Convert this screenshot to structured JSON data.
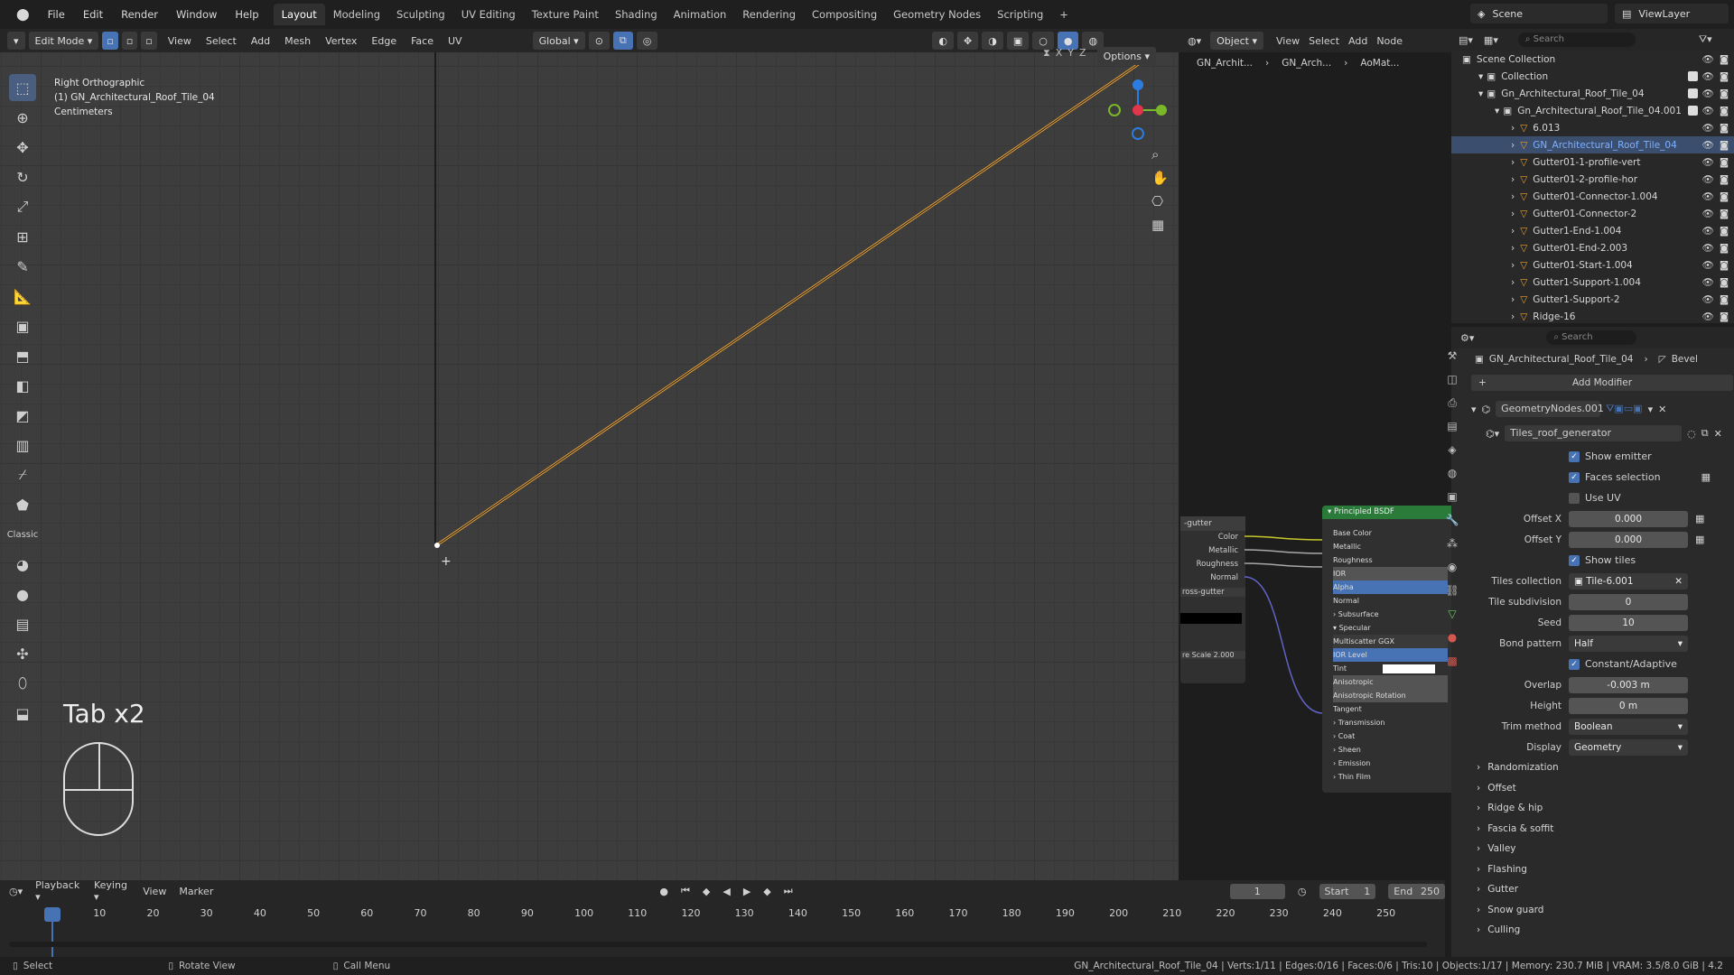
{
  "menu": [
    "File",
    "Edit",
    "Render",
    "Window",
    "Help"
  ],
  "workspaces": [
    "Layout",
    "Modeling",
    "Sculpting",
    "UV Editing",
    "Texture Paint",
    "Shading",
    "Animation",
    "Rendering",
    "Compositing",
    "Geometry Nodes",
    "Scripting"
  ],
  "active_workspace": "Layout",
  "scene": "Scene",
  "view_layer": "ViewLayer",
  "viewport_header": {
    "mode": "Edit Mode",
    "menus": [
      "View",
      "Select",
      "Add",
      "Mesh",
      "Vertex",
      "Edge",
      "Face",
      "UV"
    ],
    "transform": "Global",
    "options": "Options",
    "axes": [
      "X",
      "Y",
      "Z"
    ]
  },
  "viewport_info": [
    "Right Orthographic",
    "(1) GN_Architectural_Roof_Tile_04",
    "Centimeters"
  ],
  "key_overlay": "Tab x2",
  "node_header": {
    "object": "Object",
    "menus": [
      "View",
      "Select",
      "Add",
      "Node"
    ],
    "breadcrumb": [
      "GN_Archit...",
      "GN_Arch...",
      "AoMat..."
    ]
  },
  "nodes": {
    "left": {
      "title": "-gutter",
      "sockets": [
        "Color",
        "Metallic",
        "Roughness",
        "Normal"
      ],
      "material": "ross-gutter",
      "scale": "re Scale  2.000"
    },
    "bsdf": {
      "title": "Principled BSDF",
      "sockets": [
        "Base Color",
        "Metallic",
        "Roughness",
        "IOR",
        "Alpha",
        "Normal",
        "Subsurface",
        "Specular",
        "Multiscatter GGX",
        "IOR Level",
        "Tint",
        "Anisotropic",
        "Anisotropic Rotation",
        "Tangent",
        "Transmission",
        "Coat",
        "Sheen",
        "Emission",
        "Thin Film"
      ]
    }
  },
  "outliner": {
    "search_placeholder": "Search",
    "rows": [
      {
        "label": "Scene Collection",
        "indent": 0
      },
      {
        "label": "Collection",
        "indent": 1
      },
      {
        "label": "Gn_Architectural_Roof_Tile_04",
        "indent": 1
      },
      {
        "label": "Gn_Architectural_Roof_Tile_04.001",
        "indent": 2
      },
      {
        "label": "6.013",
        "indent": 3
      },
      {
        "label": "GN_Architectural_Roof_Tile_04",
        "indent": 3,
        "selected": true
      },
      {
        "label": "Gutter01-1-profile-vert",
        "indent": 3
      },
      {
        "label": "Gutter01-2-profile-hor",
        "indent": 3
      },
      {
        "label": "Gutter01-Connector-1.004",
        "indent": 3
      },
      {
        "label": "Gutter01-Connector-2",
        "indent": 3
      },
      {
        "label": "Gutter1-End-1.004",
        "indent": 3
      },
      {
        "label": "Gutter01-End-2.003",
        "indent": 3
      },
      {
        "label": "Gutter01-Start-1.004",
        "indent": 3
      },
      {
        "label": "Gutter1-Support-1.004",
        "indent": 3
      },
      {
        "label": "Gutter1-Support-2",
        "indent": 3
      },
      {
        "label": "Ridge-16",
        "indent": 3
      }
    ]
  },
  "properties": {
    "search_placeholder": "Search",
    "object_name": "GN_Architectural_Roof_Tile_04",
    "modifier_crumb": "Bevel",
    "add_modifier": "Add Modifier",
    "modifier_name": "GeometryNodes.001",
    "node_group": "Tiles_roof_generator",
    "checks": [
      {
        "label": "Show emitter",
        "on": true
      },
      {
        "label": "Faces selection",
        "on": true
      },
      {
        "label": "Use UV",
        "on": false
      }
    ],
    "offset_x": {
      "label": "Offset X",
      "value": "0.000"
    },
    "offset_y": {
      "label": "Offset Y",
      "value": "0.000"
    },
    "show_tiles": "Show tiles",
    "tiles_collection": {
      "label": "Tiles collection",
      "value": "Tile-6.001"
    },
    "tile_subdivision": {
      "label": "Tile subdivision",
      "value": "0"
    },
    "seed": {
      "label": "Seed",
      "value": "10"
    },
    "bond_pattern": {
      "label": "Bond pattern",
      "value": "Half"
    },
    "constant_adaptive": "Constant/Adaptive",
    "overlap": {
      "label": "Overlap",
      "value": "-0.003 m"
    },
    "height": {
      "label": "Height",
      "value": "0 m"
    },
    "trim_method": {
      "label": "Trim method",
      "value": "Boolean"
    },
    "display": {
      "label": "Display",
      "value": "Geometry"
    },
    "sections": [
      "Randomization",
      "Offset",
      "Ridge & hip",
      "Fascia & soffit",
      "Valley",
      "Flashing",
      "Gutter",
      "Snow guard",
      "Culling"
    ]
  },
  "timeline": {
    "menus": [
      "Playback",
      "Keying",
      "View",
      "Marker"
    ],
    "current_frame": "1",
    "start_label": "Start",
    "start": "1",
    "end_label": "End",
    "end": "250",
    "ticks": [
      "1",
      "10",
      "20",
      "30",
      "40",
      "50",
      "60",
      "70",
      "80",
      "90",
      "100",
      "110",
      "120",
      "130",
      "140",
      "150",
      "160",
      "170",
      "180",
      "190",
      "200",
      "210",
      "220",
      "230",
      "240",
      "250"
    ]
  },
  "statusbar": {
    "select": "Select",
    "rotate": "Rotate View",
    "call_menu": "Call Menu",
    "stats": "GN_Architectural_Roof_Tile_04 | Verts:1/11 | Edges:0/16 | Faces:0/6 | Tris:10 | Objects:1/17 | Memory: 230.7 MiB | VRAM: 3.5/8.0 GiB | 4.2"
  },
  "colors": {
    "accent": "#4772b3",
    "edge": "#e8a33a",
    "bsdf_header": "#2a7a3a"
  }
}
